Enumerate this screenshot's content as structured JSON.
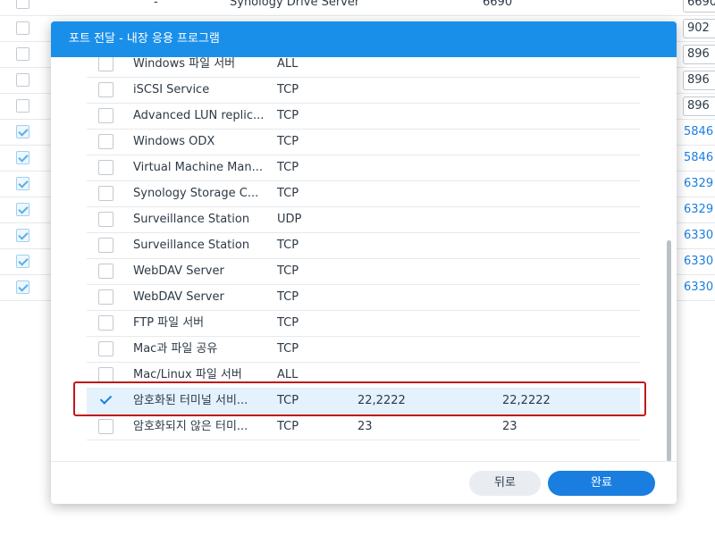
{
  "background": {
    "rows": [
      {
        "checked": false,
        "col1": "-",
        "col2": "Synology Drive Server",
        "col3": "6690",
        "field": "6690",
        "link": ""
      },
      {
        "checked": false,
        "col1": "",
        "col2": "",
        "col3": "",
        "field": "902",
        "link": ""
      },
      {
        "checked": false,
        "col1": "",
        "col2": "",
        "col3": "",
        "field": "896",
        "link": ""
      },
      {
        "checked": false,
        "col1": "",
        "col2": "",
        "col3": "",
        "field": "896",
        "link": ""
      },
      {
        "checked": false,
        "col1": "",
        "col2": "",
        "col3": "",
        "field": "896",
        "link": ""
      },
      {
        "checked": true,
        "col1": "",
        "col2": "",
        "col3": "",
        "field": "",
        "link": "5846"
      },
      {
        "checked": true,
        "col1": "",
        "col2": "",
        "col3": "",
        "field": "",
        "link": "5846"
      },
      {
        "checked": true,
        "col1": "",
        "col2": "",
        "col3": "",
        "field": "",
        "link": "6329"
      },
      {
        "checked": true,
        "col1": "",
        "col2": "",
        "col3": "",
        "field": "",
        "link": "6329"
      },
      {
        "checked": true,
        "col1": "",
        "col2": "",
        "col3": "",
        "field": "",
        "link": "6330"
      },
      {
        "checked": true,
        "col1": "",
        "col2": "",
        "col3": "",
        "field": "",
        "link": "6330"
      },
      {
        "checked": true,
        "col1": "",
        "col2": "",
        "col3": "",
        "field": "",
        "link": "6330"
      }
    ]
  },
  "dialog": {
    "title": "포트 전달 - 내장 응용 프로그램",
    "rows": [
      {
        "checked": false,
        "name": "Windows 파일 서버",
        "protocol": "ALL",
        "port1": "",
        "port2": ""
      },
      {
        "checked": false,
        "name": "iSCSI Service",
        "protocol": "TCP",
        "port1": "",
        "port2": ""
      },
      {
        "checked": false,
        "name": "Advanced LUN replic...",
        "protocol": "TCP",
        "port1": "",
        "port2": ""
      },
      {
        "checked": false,
        "name": "Windows ODX",
        "protocol": "TCP",
        "port1": "",
        "port2": ""
      },
      {
        "checked": false,
        "name": "Virtual Machine Man...",
        "protocol": "TCP",
        "port1": "",
        "port2": ""
      },
      {
        "checked": false,
        "name": "Synology Storage C...",
        "protocol": "TCP",
        "port1": "",
        "port2": ""
      },
      {
        "checked": false,
        "name": "Surveillance Station",
        "protocol": "UDP",
        "port1": "",
        "port2": ""
      },
      {
        "checked": false,
        "name": "Surveillance Station",
        "protocol": "TCP",
        "port1": "",
        "port2": ""
      },
      {
        "checked": false,
        "name": "WebDAV Server",
        "protocol": "TCP",
        "port1": "",
        "port2": ""
      },
      {
        "checked": false,
        "name": "WebDAV Server",
        "protocol": "TCP",
        "port1": "",
        "port2": ""
      },
      {
        "checked": false,
        "name": "FTP 파일 서버",
        "protocol": "TCP",
        "port1": "",
        "port2": ""
      },
      {
        "checked": false,
        "name": "Mac과 파일 공유",
        "protocol": "TCP",
        "port1": "",
        "port2": ""
      },
      {
        "checked": false,
        "name": "Mac/Linux 파일 서버",
        "protocol": "ALL",
        "port1": "",
        "port2": ""
      },
      {
        "checked": true,
        "name": "암호화된 터미널 서비...",
        "protocol": "TCP",
        "port1": "22,2222",
        "port2": "22,2222",
        "selected": true
      },
      {
        "checked": false,
        "name": "암호화되지 않은 터미...",
        "protocol": "TCP",
        "port1": "23",
        "port2": "23"
      }
    ],
    "back_label": "뒤로",
    "done_label": "완료"
  },
  "colors": {
    "accent": "#1a7ee0",
    "header": "#1a8fea",
    "selected_row": "#e3f2fd",
    "highlight_box": "#c0181a"
  }
}
